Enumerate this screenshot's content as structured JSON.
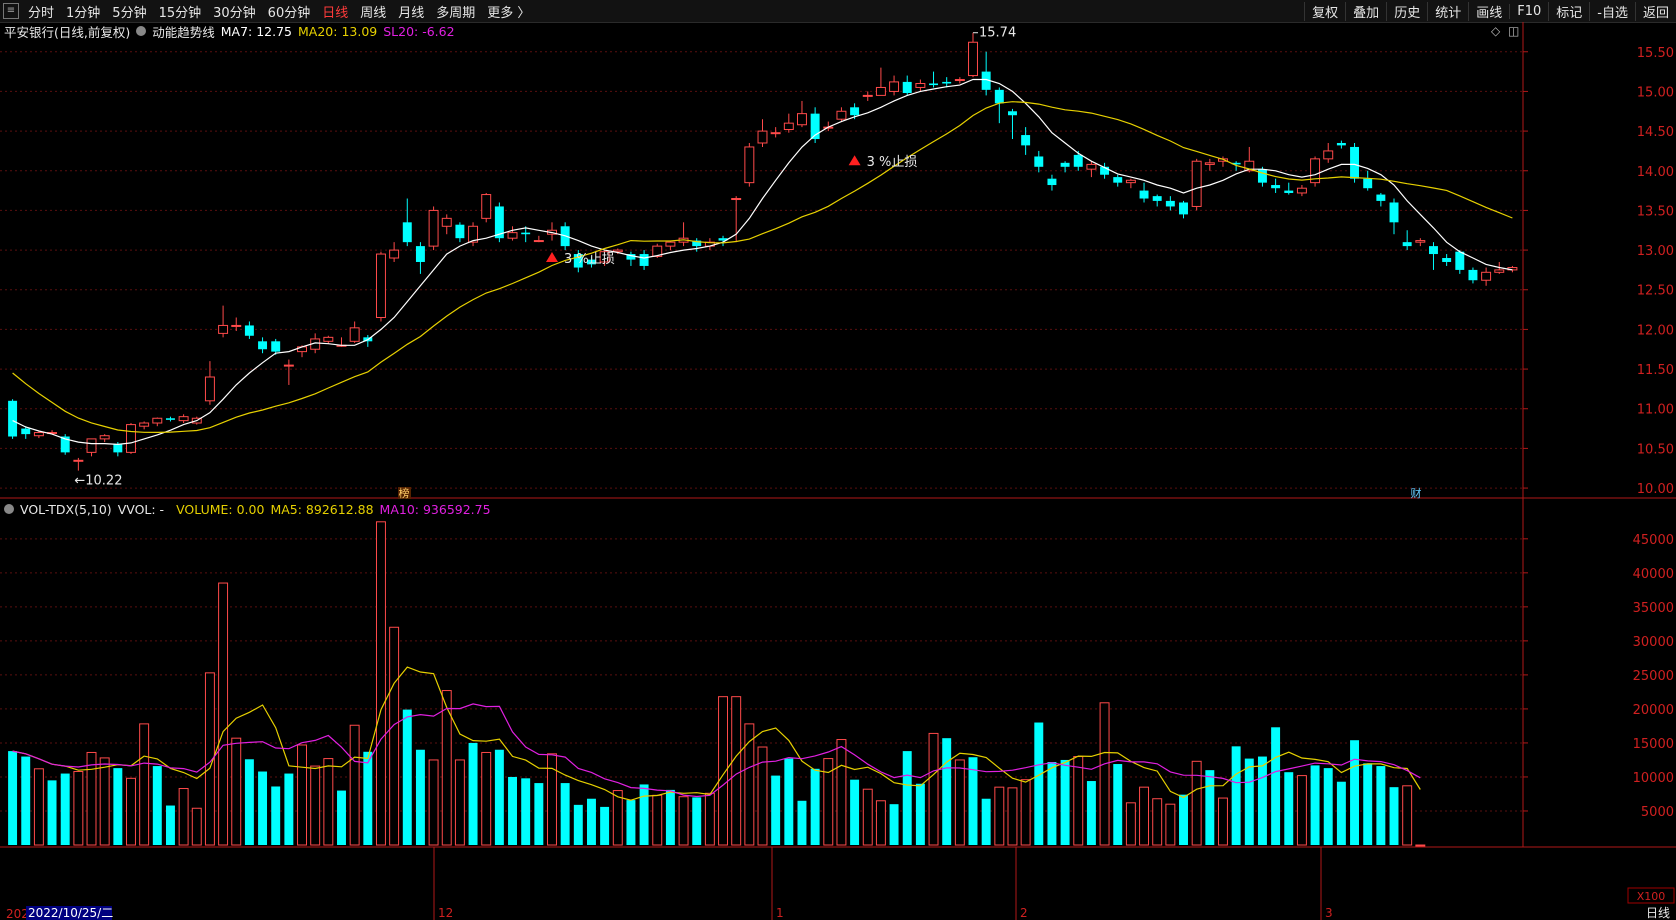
{
  "toolbar": {
    "menu_icon": "menu-grid-icon",
    "left_items": [
      "分时",
      "1分钟",
      "5分钟",
      "15分钟",
      "30分钟",
      "60分钟",
      "日线",
      "周线",
      "月线",
      "多周期",
      "更多 〉"
    ],
    "active_index": 6,
    "right_items": [
      "复权",
      "叠加",
      "历史",
      "统计",
      "画线",
      "F10",
      "标记",
      "-自选",
      "返回"
    ]
  },
  "main_legend": {
    "stock": "平安银行(日线,前复权)",
    "indicator": "动能趋势线",
    "ma7": "MA7: 12.75",
    "ma20": "MA20: 13.09",
    "sl20": "SL20: -6.62"
  },
  "vol_legend": {
    "name": "VOL-TDX(5,10)",
    "vvol": "VVOL: -",
    "volume": "VOLUME: 0.00",
    "ma5": "MA5: 892612.88",
    "ma10": "MA10: 936592.75"
  },
  "annotations": {
    "high": "15.74",
    "low": "10.22",
    "stop1": "3 %止损",
    "stop2": "3 %止损",
    "marker1": "榜",
    "marker2": "财"
  },
  "bottom": {
    "year_fragment": "202",
    "date_label": "2022/10/25/二",
    "month_labels": [
      "12",
      "1",
      "2",
      "3"
    ],
    "unit_label": "X100",
    "period_label": "日线"
  },
  "colors": {
    "up": "#ff4a4a",
    "down": "#00ffff",
    "ma7": "#ffffff",
    "ma20": "#e6d000",
    "ma10_vol": "#e020e0",
    "axis": "#b01818"
  },
  "chart_data": [
    {
      "type": "candlestick",
      "title": "平安银行(日线,前复权)",
      "y_ticks": [
        10.0,
        10.5,
        11.0,
        11.5,
        12.0,
        12.5,
        13.0,
        13.5,
        14.0,
        14.5,
        15.0,
        15.5
      ],
      "ylim": [
        9.9,
        15.85
      ],
      "up_color": "#ff4a4a",
      "down_color": "#00ffff",
      "candles": [
        [
          11.1,
          10.65,
          11.12,
          10.62
        ],
        [
          10.75,
          10.68,
          10.78,
          10.62
        ],
        [
          10.66,
          10.7,
          10.72,
          10.63
        ],
        [
          10.7,
          10.7,
          10.73,
          10.68
        ],
        [
          10.65,
          10.45,
          10.68,
          10.42
        ],
        [
          10.35,
          10.35,
          10.38,
          10.22
        ],
        [
          10.45,
          10.62,
          10.62,
          10.4
        ],
        [
          10.62,
          10.66,
          10.68,
          10.58
        ],
        [
          10.55,
          10.45,
          10.58,
          10.4
        ],
        [
          10.45,
          10.8,
          10.82,
          10.43
        ],
        [
          10.78,
          10.82,
          10.84,
          10.74
        ],
        [
          10.82,
          10.88,
          10.89,
          10.78
        ],
        [
          10.88,
          10.86,
          10.9,
          10.84
        ],
        [
          10.85,
          10.9,
          10.93,
          10.82
        ],
        [
          10.82,
          10.88,
          10.9,
          10.8
        ],
        [
          11.1,
          11.4,
          11.6,
          11.05
        ],
        [
          11.95,
          12.05,
          12.3,
          11.9
        ],
        [
          12.05,
          12.05,
          12.15,
          11.98
        ],
        [
          12.05,
          11.92,
          12.1,
          11.88
        ],
        [
          11.85,
          11.75,
          11.9,
          11.7
        ],
        [
          11.85,
          11.72,
          11.88,
          11.68
        ],
        [
          11.55,
          11.55,
          11.62,
          11.3
        ],
        [
          11.72,
          11.78,
          11.8,
          11.65
        ],
        [
          11.75,
          11.88,
          11.95,
          11.7
        ],
        [
          11.85,
          11.9,
          11.92,
          11.82
        ],
        [
          11.8,
          11.8,
          11.9,
          11.78
        ],
        [
          11.85,
          12.02,
          12.1,
          11.83
        ],
        [
          11.9,
          11.85,
          11.93,
          11.78
        ],
        [
          12.15,
          12.95,
          12.98,
          12.1
        ],
        [
          12.9,
          13.0,
          13.1,
          12.85
        ],
        [
          13.35,
          13.1,
          13.65,
          13.05
        ],
        [
          13.05,
          12.85,
          13.1,
          12.7
        ],
        [
          13.05,
          13.5,
          13.55,
          13.0
        ],
        [
          13.3,
          13.4,
          13.45,
          13.2
        ],
        [
          13.32,
          13.15,
          13.35,
          13.1
        ],
        [
          13.1,
          13.3,
          13.35,
          13.05
        ],
        [
          13.4,
          13.7,
          13.72,
          13.35
        ],
        [
          13.55,
          13.15,
          13.6,
          13.1
        ],
        [
          13.15,
          13.22,
          13.3,
          13.12
        ],
        [
          13.22,
          13.2,
          13.3,
          13.1
        ],
        [
          13.12,
          13.12,
          13.18,
          13.1
        ],
        [
          13.2,
          13.25,
          13.35,
          13.12
        ],
        [
          13.3,
          13.05,
          13.35,
          13.0
        ],
        [
          12.95,
          12.78,
          13.0,
          12.72
        ],
        [
          12.88,
          12.82,
          12.92,
          12.78
        ],
        [
          12.85,
          12.98,
          13.0,
          12.8
        ],
        [
          12.98,
          13.0,
          13.02,
          12.95
        ],
        [
          12.95,
          12.88,
          12.98,
          12.8
        ],
        [
          12.95,
          12.8,
          13.0,
          12.75
        ],
        [
          12.92,
          13.05,
          13.08,
          12.9
        ],
        [
          13.05,
          13.1,
          13.12,
          13.0
        ],
        [
          13.1,
          13.15,
          13.35,
          13.05
        ],
        [
          13.12,
          13.05,
          13.15,
          12.98
        ],
        [
          13.05,
          13.1,
          13.15,
          13.0
        ],
        [
          13.15,
          13.12,
          13.18,
          13.05
        ],
        [
          13.65,
          13.65,
          13.68,
          13.1
        ],
        [
          13.85,
          14.3,
          14.35,
          13.8
        ],
        [
          14.35,
          14.5,
          14.65,
          14.3
        ],
        [
          14.48,
          14.48,
          14.55,
          14.42
        ],
        [
          14.52,
          14.6,
          14.72,
          14.48
        ],
        [
          14.58,
          14.72,
          14.88,
          14.55
        ],
        [
          14.72,
          14.4,
          14.8,
          14.35
        ],
        [
          14.55,
          14.55,
          14.62,
          14.5
        ],
        [
          14.65,
          14.75,
          14.8,
          14.62
        ],
        [
          14.8,
          14.7,
          14.85,
          14.65
        ],
        [
          14.95,
          14.95,
          15.0,
          14.88
        ],
        [
          14.95,
          15.05,
          15.3,
          14.95
        ],
        [
          15.0,
          15.12,
          15.2,
          14.95
        ],
        [
          15.12,
          14.98,
          15.2,
          14.95
        ],
        [
          15.05,
          15.1,
          15.15,
          15.0
        ],
        [
          15.1,
          15.08,
          15.25,
          15.05
        ],
        [
          15.12,
          15.1,
          15.18,
          15.05
        ],
        [
          15.15,
          15.15,
          15.18,
          15.1
        ],
        [
          15.2,
          15.62,
          15.74,
          15.18
        ],
        [
          15.25,
          15.02,
          15.5,
          14.95
        ],
        [
          15.02,
          14.85,
          15.05,
          14.6
        ],
        [
          14.75,
          14.7,
          14.78,
          14.4
        ],
        [
          14.45,
          14.32,
          14.55,
          14.2
        ],
        [
          14.18,
          14.05,
          14.25,
          13.98
        ],
        [
          13.9,
          13.82,
          13.95,
          13.75
        ],
        [
          14.1,
          14.05,
          14.12,
          13.98
        ],
        [
          14.2,
          14.05,
          14.25,
          14.0
        ],
        [
          14.02,
          14.08,
          14.12,
          13.92
        ],
        [
          14.05,
          13.95,
          14.1,
          13.9
        ],
        [
          13.92,
          13.85,
          13.95,
          13.8
        ],
        [
          13.85,
          13.88,
          13.9,
          13.78
        ],
        [
          13.75,
          13.65,
          13.85,
          13.6
        ],
        [
          13.68,
          13.62,
          13.7,
          13.55
        ],
        [
          13.62,
          13.55,
          13.68,
          13.5
        ],
        [
          13.6,
          13.45,
          13.62,
          13.4
        ],
        [
          13.55,
          14.12,
          14.15,
          13.5
        ],
        [
          14.08,
          14.1,
          14.15,
          14.0
        ],
        [
          14.12,
          14.15,
          14.18,
          14.05
        ],
        [
          14.1,
          14.08,
          14.12,
          14.0
        ],
        [
          14.0,
          14.12,
          14.3,
          13.98
        ],
        [
          14.02,
          13.85,
          14.05,
          13.8
        ],
        [
          13.82,
          13.78,
          13.9,
          13.72
        ],
        [
          13.75,
          13.72,
          13.85,
          13.7
        ],
        [
          13.72,
          13.78,
          13.82,
          13.68
        ],
        [
          13.85,
          14.15,
          14.18,
          13.8
        ],
        [
          14.15,
          14.25,
          14.35,
          14.1
        ],
        [
          14.35,
          14.32,
          14.38,
          14.28
        ],
        [
          14.3,
          13.9,
          14.35,
          13.85
        ],
        [
          13.9,
          13.78,
          14.0,
          13.75
        ],
        [
          13.7,
          13.62,
          13.72,
          13.55
        ],
        [
          13.6,
          13.35,
          13.65,
          13.2
        ],
        [
          13.1,
          13.05,
          13.25,
          13.0
        ],
        [
          13.1,
          13.12,
          13.15,
          13.05
        ],
        [
          13.05,
          12.95,
          13.1,
          12.75
        ],
        [
          12.9,
          12.85,
          12.95,
          12.8
        ],
        [
          12.98,
          12.75,
          13.0,
          12.7
        ],
        [
          12.75,
          12.62,
          12.78,
          12.58
        ],
        [
          12.62,
          12.72,
          12.78,
          12.55
        ],
        [
          12.72,
          12.75,
          12.85,
          12.7
        ],
        [
          12.75,
          12.78,
          12.8,
          12.72
        ]
      ],
      "ma7": [
        10.85,
        10.77,
        10.72,
        10.68,
        10.62,
        10.58,
        10.56,
        10.56,
        10.55,
        10.57,
        10.62,
        10.67,
        10.73,
        10.8,
        10.85,
        10.95,
        11.12,
        11.3,
        11.45,
        11.58,
        11.7,
        11.72,
        11.78,
        11.83,
        11.82,
        11.8,
        11.8,
        11.87,
        12.0,
        12.15,
        12.35,
        12.55,
        12.75,
        12.95,
        13.05,
        13.12,
        13.15,
        13.2,
        13.25,
        13.28,
        13.25,
        13.22,
        13.18,
        13.12,
        13.05,
        13.0,
        12.97,
        12.93,
        12.9,
        12.93,
        12.97,
        13.0,
        13.02,
        13.05,
        13.1,
        13.2,
        13.4,
        13.65,
        13.88,
        14.1,
        14.3,
        14.45,
        14.55,
        14.62,
        14.68,
        14.73,
        14.8,
        14.88,
        14.95,
        15.0,
        15.03,
        15.06,
        15.08,
        15.15,
        15.15,
        15.1,
        15.0,
        14.85,
        14.68,
        14.48,
        14.35,
        14.22,
        14.12,
        14.04,
        13.96,
        13.92,
        13.88,
        13.82,
        13.78,
        13.72,
        13.78,
        13.82,
        13.88,
        13.96,
        14.02,
        14.02,
        14.0,
        13.95,
        13.92,
        13.95,
        14.02,
        14.08,
        14.08,
        14.03,
        13.95,
        13.82,
        13.62,
        13.45,
        13.28,
        13.1,
        12.98,
        12.9,
        12.82,
        12.78,
        12.75
      ]
    },
    {
      "type": "bar",
      "title": "VOL-TDX(5,10)",
      "unit": "X100",
      "y_ticks": [
        5000,
        10000,
        15000,
        20000,
        25000,
        30000,
        35000,
        40000,
        45000
      ],
      "ylim": [
        0,
        48500
      ],
      "volumes": [
        13800,
        13000,
        11200,
        9500,
        10500,
        10800,
        13600,
        12800,
        11300,
        9800,
        17800,
        11600,
        5800,
        8300,
        5400,
        25300,
        38500,
        15700,
        12600,
        10800,
        8600,
        10500,
        14700,
        11600,
        12700,
        8000,
        17600,
        13700,
        47500,
        32000,
        19900,
        14000,
        12500,
        22700,
        12500,
        15000,
        13600,
        14000,
        10000,
        9800,
        9100,
        13400,
        9100,
        5900,
        6800,
        5600,
        8000,
        6600,
        8900,
        7300,
        8100,
        7100,
        7000,
        7600,
        21800,
        21800,
        17800,
        14400,
        10200,
        12700,
        6500,
        11200,
        12700,
        15500,
        9600,
        8200,
        6500,
        6000,
        13800,
        9000,
        16400,
        15700,
        12500,
        12900,
        6800,
        8500,
        8400,
        9600,
        18000,
        12200,
        12500,
        13000,
        9400,
        20900,
        11900,
        6200,
        8500,
        6800,
        6000,
        7400,
        12300,
        11000,
        6900,
        14500,
        12700,
        13000,
        17300,
        10700,
        10200,
        11700,
        11300,
        9300,
        15400,
        12000,
        11600,
        8500,
        8700,
        0
      ],
      "up_flags": [
        0,
        0,
        1,
        0,
        0,
        1,
        1,
        1,
        0,
        1,
        1,
        0,
        0,
        1,
        1,
        1,
        1,
        1,
        0,
        0,
        0,
        0,
        1,
        1,
        1,
        0,
        1,
        0,
        1,
        1,
        0,
        0,
        1,
        1,
        1,
        0,
        1,
        0,
        0,
        0,
        0,
        1,
        0,
        0,
        0,
        0,
        1,
        0,
        0,
        1,
        0,
        1,
        0,
        1,
        1,
        1,
        1,
        1,
        0,
        0,
        0,
        0,
        1,
        1,
        0,
        1,
        1,
        0,
        0,
        0,
        1,
        0,
        1,
        0,
        0,
        1,
        1,
        1,
        0,
        0,
        0,
        1,
        0,
        1,
        0,
        1,
        1,
        1,
        1,
        0,
        1,
        0,
        1,
        0,
        0,
        0,
        0,
        0,
        1,
        0,
        0,
        0,
        0,
        0,
        0,
        0,
        1,
        1,
        1,
        0
      ]
    }
  ]
}
